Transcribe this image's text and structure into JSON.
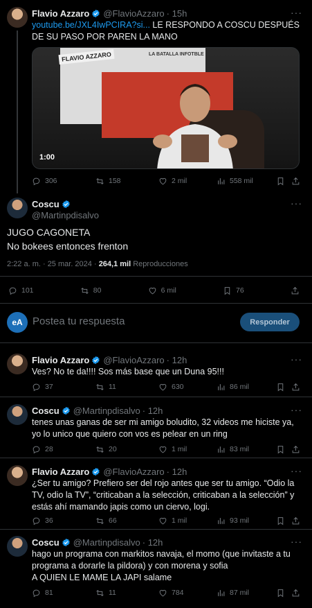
{
  "colors": {
    "background": "#000000",
    "accent": "#1d9bf0",
    "muted": "#71767b",
    "divider": "#2f3336"
  },
  "top_tweet": {
    "name": "Flavio Azzaro",
    "handle": "@FlavioAzzaro",
    "time": "· 15h",
    "link": "youtube.be/JXL4IwPCIRA?si...",
    "text": "LE RESPONDO A COSCU DESPUÉS DE SU PASO POR PAREN LA MANO",
    "video": {
      "logo": "FLAVIO AZZARO",
      "banner": "LA BATALLA INFOTBLE",
      "duration": "1:00"
    },
    "stats": {
      "replies": "306",
      "reposts": "158",
      "likes": "2 mil",
      "views": "558 mil"
    }
  },
  "main_tweet": {
    "name": "Coscu",
    "handle": "@Martinpdisalvo",
    "lines": [
      "JUGO CAGONETA",
      "No bokees entonces frenton"
    ],
    "time": "2:22 a. m. · 25 mar. 2024 ·",
    "views_count": "264,1 mil",
    "views_label": "Reproducciones",
    "stats": {
      "replies": "101",
      "reposts": "80",
      "likes": "6 mil",
      "bookmarks": "76"
    }
  },
  "reply_box": {
    "avatar": "eA",
    "placeholder": "Postea tu respuesta",
    "button": "Responder"
  },
  "replies": [
    {
      "name": "Flavio Azzaro",
      "handle": "@FlavioAzzaro",
      "time": "· 12h",
      "text": "Ves? No te da!!!! Sos más base que un Duna 95!!!",
      "stats": {
        "replies": "37",
        "reposts": "11",
        "likes": "630",
        "views": "86 mil"
      }
    },
    {
      "name": "Coscu",
      "handle": "@Martinpdisalvo",
      "time": "· 12h",
      "text": "tenes unas ganas de ser mi amigo boludito, 32 videos me hiciste ya, yo lo unico que quiero con vos es pelear en un ring",
      "stats": {
        "replies": "28",
        "reposts": "20",
        "likes": "1 mil",
        "views": "83 mil"
      }
    },
    {
      "name": "Flavio Azzaro",
      "handle": "@FlavioAzzaro",
      "time": "· 12h",
      "text": "¿Ser tu amigo? Prefiero ser del rojo antes que ser tu amigo. “Odio la TV, odio la TV”, “criticaban a la selección, criticaban a la selección” y estás ahí mamando japis como un ciervo, logi.",
      "stats": {
        "replies": "36",
        "reposts": "66",
        "likes": "1 mil",
        "views": "93 mil"
      }
    },
    {
      "name": "Coscu",
      "handle": "@Martinpdisalvo",
      "time": "· 12h",
      "text": "hago un programa con markitos navaja, el momo (que invitaste a tu programa a dorarle la pildora) y con morena y sofia\nA QUIEN LE MAME LA JAPI salame",
      "stats": {
        "replies": "81",
        "reposts": "11",
        "likes": "784",
        "views": "87 mil"
      }
    }
  ]
}
